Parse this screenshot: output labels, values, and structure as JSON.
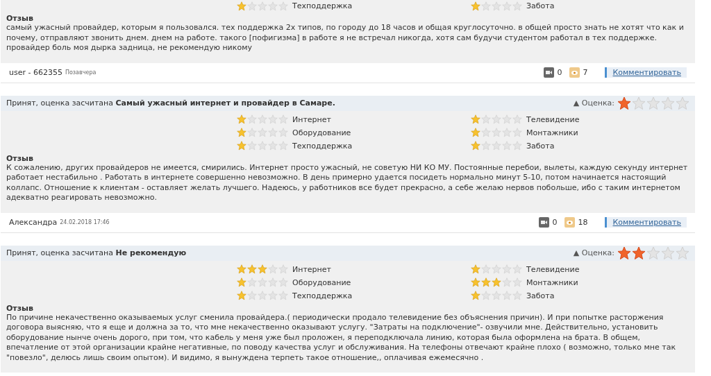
{
  "reviews": [
    {
      "criteria": [
        {
          "label": "Техподдержка",
          "stars": 1
        },
        {
          "label": "Забота",
          "stars": 1
        }
      ],
      "review_label": "Отзыв",
      "text": "самый ужасный провайдер, которым я пользовался. тех поддержка 2х типов, по городу до 18 часов и общая круглосуточно. в общей просто знать не хотят что как и почему, отправляют звонить днем. днем на работе. такого [пофигизма] в работе я не встречал никогда, хотя сам будучи студентом работал в тех поддержке. провайдер боль моя дырка задница, не рекомендую никому",
      "author": "user - 662355",
      "date": "Позавчера",
      "comments": "0",
      "views": "7",
      "comment_link": "Комментировать"
    },
    {
      "status": "Принят, оценка засчитана",
      "title": "Самый ужасный интернет и провайдер в Самаре.",
      "rating_label": "▲ Оценка:",
      "stars": 1,
      "criteria": [
        {
          "label": "Интернет",
          "stars": 1
        },
        {
          "label": "Телевидение",
          "stars": 1
        },
        {
          "label": "Оборудование",
          "stars": 1
        },
        {
          "label": "Монтажники",
          "stars": 1
        },
        {
          "label": "Техподдержка",
          "stars": 1
        },
        {
          "label": "Забота",
          "stars": 1
        }
      ],
      "review_label": "Отзыв",
      "text": "К сожалению, других провайдеров не имеется, смирились. Интернет просто ужасный, не советую НИ КО МУ. Постоянные перебои, вылеты, каждую секунду интернет работает нестабильно . Работать в интернете совершенно невозможно. В день примерно удается посидеть нормально минут 5-10, потом начинается настоящий коллапс. Отношение к клиентам - оставляет желать лучшего. Надеюсь, у работников все будет прекрасно, а себе желаю нервов побольше, ибо с таким интернетом адекватно реагировать невозможно.",
      "author": "Александра",
      "date": "24.02.2018 17:46",
      "comments": "0",
      "views": "18",
      "comment_link": "Комментировать"
    },
    {
      "status": "Принят, оценка засчитана",
      "title": "Не рекомендую",
      "rating_label": "▲ Оценка:",
      "stars": 2,
      "criteria": [
        {
          "label": "Интернет",
          "stars": 3
        },
        {
          "label": "Телевидение",
          "stars": 1
        },
        {
          "label": "Оборудование",
          "stars": 1
        },
        {
          "label": "Монтажники",
          "stars": 3
        },
        {
          "label": "Техподдержка",
          "stars": 1
        },
        {
          "label": "Забота",
          "stars": 1
        }
      ],
      "review_label": "Отзыв",
      "text": "По причине некачественно оказываемых услуг сменила провайдера.( периодически продало телевидение без объяснения причин). И при попытке расторжения договора выясняю, что я еще и должна за то, что мне некачественно оказывают услугу. \"Затраты на подключение\"- озвучили мне. Действительно, установить оборудование нынче очень дорого, при том, что кабель у меня уже был проложен, я переподключала линию, которая была оформлена на брата. В общем, впечатление от этой организации крайне негативные, по поводу качества услуг и обслуживания. На телефоны отвечают крайне плохо ( возможно, только мне так \"повезло\", делюсь лишь своим опытом). И видимо, я вынуждена терпеть такое отношение,, оплачивая ежемесячно ."
    }
  ]
}
